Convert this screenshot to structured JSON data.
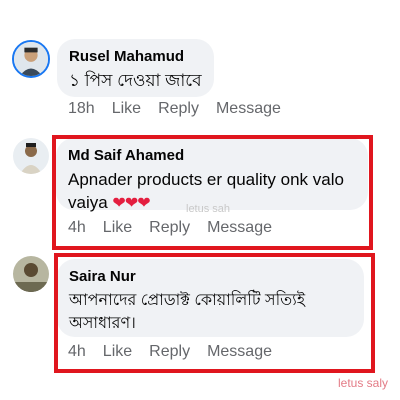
{
  "comments": [
    {
      "author": "Rusel Mahamud",
      "text": "১ পিস দেওয়া  জাবে",
      "time": "18h",
      "like": "Like",
      "reply": "Reply",
      "message": "Message"
    },
    {
      "author": "Md Saif Ahamed",
      "text": "Apnader products er quality onk valo vaiya",
      "hearts": "❤❤❤",
      "time": "4h",
      "like": "Like",
      "reply": "Reply",
      "message": "Message"
    },
    {
      "author": "Saira Nur",
      "text": "আপনাদের প্রোডাক্ট কোয়ালিটি সত্যিই অসাধারণ।",
      "time": "4h",
      "like": "Like",
      "reply": "Reply",
      "message": "Message"
    }
  ],
  "watermarks": {
    "faint": "letus sah",
    "corner": "letus saly"
  },
  "colors": {
    "highlight_border": "#e0161e",
    "bubble": "#f0f2f5",
    "secondary_text": "#65676b"
  }
}
